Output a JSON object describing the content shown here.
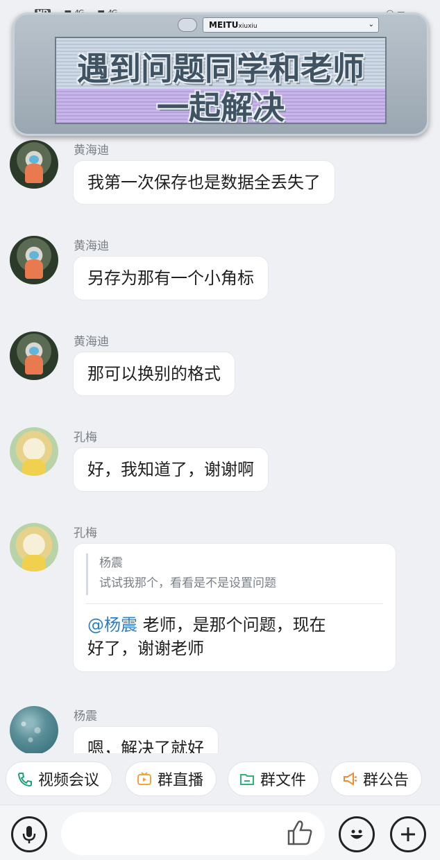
{
  "status_bar": {
    "left": "HD",
    "signal1": "4G",
    "signal2": "4G",
    "time": ""
  },
  "banner": {
    "tab_label": "MEITU",
    "tab_sub": "xiuxiu",
    "line1": "遇到问题同学和老师",
    "line2": "一起解决"
  },
  "messages": [
    {
      "sender": "黄海迪",
      "text": "我第一次保存也是数据全丢失了"
    },
    {
      "sender": "黄海迪",
      "text": "另存为那有一个小角标"
    },
    {
      "sender": "黄海迪",
      "text": "那可以换别的格式"
    },
    {
      "sender": "孔梅",
      "text": "好，我知道了，谢谢啊"
    },
    {
      "sender": "孔梅",
      "quote_name": "杨震",
      "quote_text": "试试我那个，看看是不是设置问题",
      "mention": "@杨震",
      "reply_line1": " 老师，是那个问题，现在",
      "reply_line2": "好了，谢谢老师"
    },
    {
      "sender": "杨震",
      "text": "嗯，解决了就好"
    }
  ],
  "chips": [
    {
      "label": "视频会议",
      "icon": "video-call-icon",
      "color": "#1aa37a"
    },
    {
      "label": "群直播",
      "icon": "live-tv-icon",
      "color": "#f2a43a"
    },
    {
      "label": "群文件",
      "icon": "folder-icon",
      "color": "#2bb673"
    },
    {
      "label": "群公告",
      "icon": "megaphone-icon",
      "color": "#f08c2e"
    }
  ],
  "input": {
    "placeholder": ""
  }
}
